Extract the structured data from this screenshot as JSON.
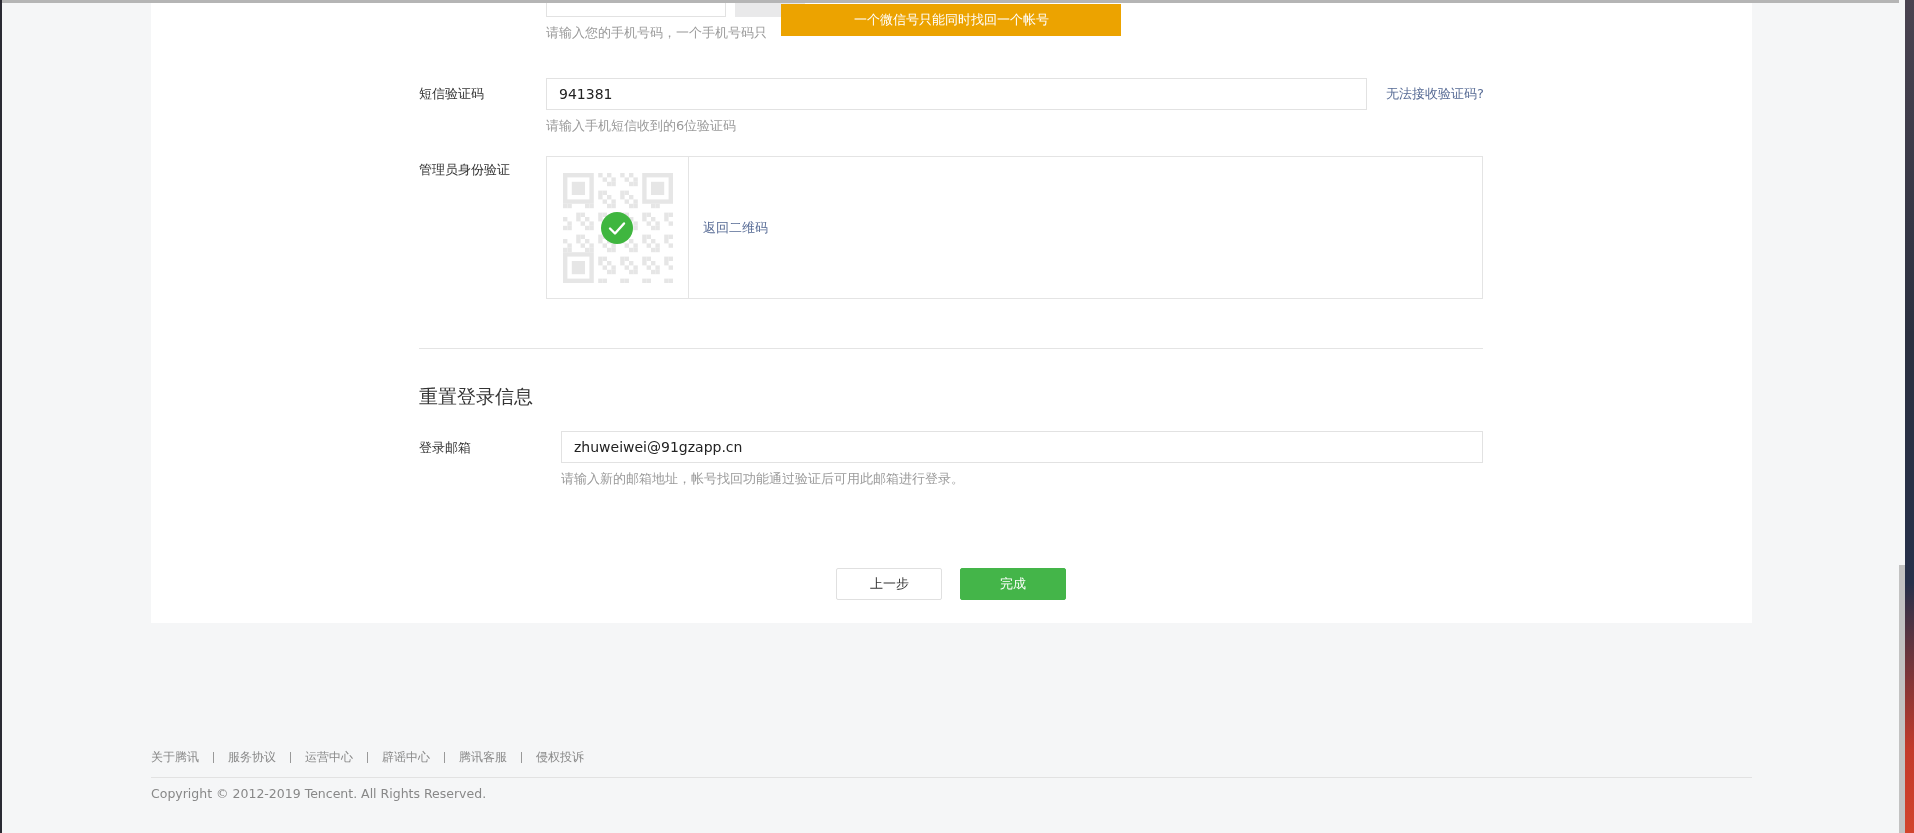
{
  "toast": {
    "text": "一个微信号只能同时找回一个帐号"
  },
  "phone_row": {
    "hint": "请输入您的手机号码，一个手机号码只"
  },
  "sms_row": {
    "label": "短信验证码",
    "value": "941381",
    "link": "无法接收验证码?",
    "hint": "请输入手机短信收到的6位验证码"
  },
  "admin_row": {
    "label": "管理员身份验证",
    "verified": true,
    "link": "返回二维码"
  },
  "reset_section": {
    "title": "重置登录信息",
    "label": "登录邮箱",
    "value": "zhuweiwei@91gzapp.cn",
    "hint": "请输入新的邮箱地址，帐号找回功能通过验证后可用此邮箱进行登录。"
  },
  "buttons": [
    {
      "label": "上一步",
      "kind": "secondary"
    },
    {
      "label": "完成",
      "kind": "primary"
    }
  ],
  "footer": {
    "links": [
      "关于腾讯",
      "服务协议",
      "运营中心",
      "辟谣中心",
      "腾讯客服",
      "侵权投诉"
    ],
    "copyright": "Copyright © 2012-2019 Tencent. All Rights Reserved."
  }
}
